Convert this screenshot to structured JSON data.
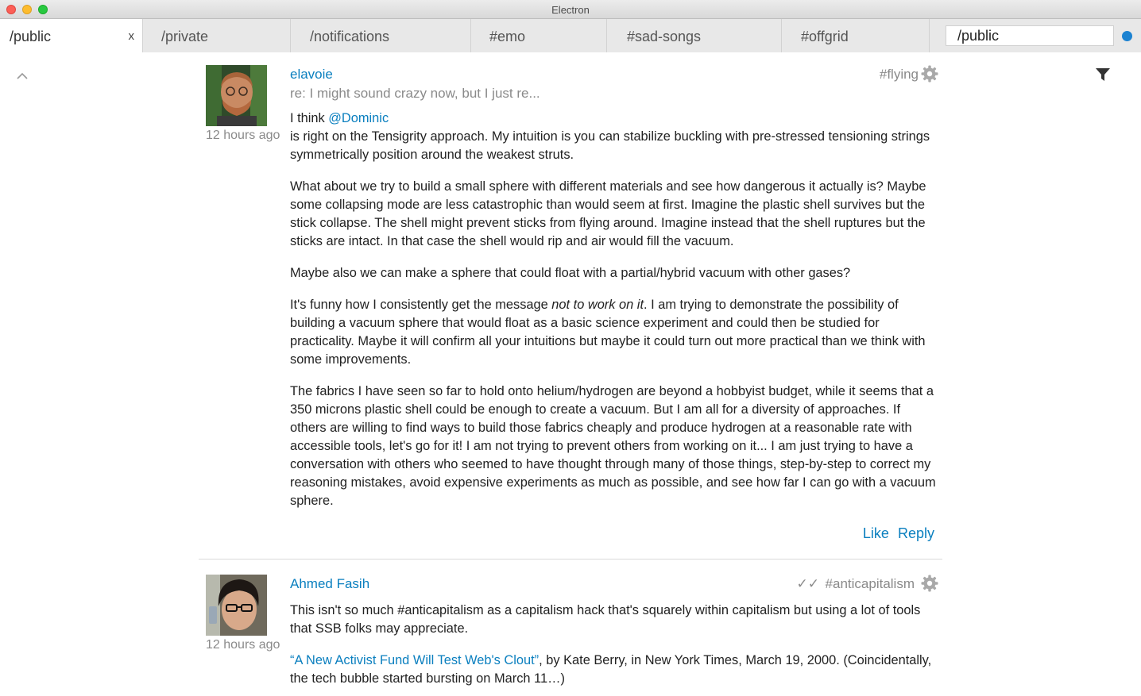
{
  "window": {
    "title": "Electron"
  },
  "tabs": [
    {
      "label": "/public",
      "close": "x"
    },
    {
      "label": "/private"
    },
    {
      "label": "/notifications"
    },
    {
      "label": "#emo"
    },
    {
      "label": "#sad-songs"
    },
    {
      "label": "#offgrid"
    }
  ],
  "search": {
    "value": "/public"
  },
  "icons": {
    "collapse": "chevron-up-icon",
    "filter": "filter-icon",
    "gear": "gear-icon",
    "status": "status-dot"
  },
  "colors": {
    "link": "#0a7fbf",
    "status_dot": "#1b82d1",
    "muted": "#8a8a8a"
  },
  "messages": [
    {
      "author": "elavoie",
      "subject": "re: I might sound crazy now, but I just re...",
      "channel": "#flying",
      "time": "12 hours ago",
      "intro": "I think ",
      "mention": "@Dominic",
      "p1": "is right on the Tensigrity approach. My intuition is you can stabilize buckling with pre-stressed tensioning strings symmetrically position around the weakest struts.",
      "p2": "What about we try to build a small sphere with different materials and see how dangerous it actually is? Maybe some collapsing mode are less catastrophic than would seem at first. Imagine the plastic shell survives but the stick collapse. The shell might prevent sticks from flying around. Imagine instead that the shell ruptures but the sticks are intact. In that case the shell would rip and air would fill the vacuum.",
      "p3": "Maybe also we can make a sphere that could float with a partial/hybrid vacuum with other gases?",
      "p4a": "It's funny how I consistently get the message ",
      "p4em": "not to work on it",
      "p4b": ". I am trying to demonstrate the possibility of building a vacuum sphere that would float as a basic science experiment and could then be studied for practicality. Maybe it will confirm all your intuitions but maybe it could turn out more practical than we think with some improvements.",
      "p5": "The fabrics I have seen so far to hold onto helium/hydrogen are beyond a hobbyist budget, while it seems that a 350 microns plastic shell could be enough to create a vacuum. But I am all for a diversity of approaches. If others are willing to find ways to build those fabrics cheaply and produce hydrogen at a reasonable rate with accessible tools, let's go for it! I am not trying to prevent others from working on it... I am just trying to have a conversation with others who seemed to have thought through many of those things, step-by-step to correct my reasoning mistakes, avoid expensive experiments as much as possible, and see how far I can go with a vacuum sphere.",
      "like": "Like",
      "reply": "Reply"
    },
    {
      "author": "Ahmed Fasih",
      "checks": "✓✓",
      "channel": "#anticapitalism",
      "time": "12 hours ago",
      "p1": "This isn't so much #anticapitalism as a capitalism hack that's squarely within capitalism but using a lot of tools that SSB folks may appreciate.",
      "link_text": "“A New Activist Fund Will Test Web's Clout”",
      "p2_after": ", by Kate Berry, in New York Times, March 19, 2000. (Coincidentally, the tech bubble started bursting on March 11…)"
    }
  ]
}
